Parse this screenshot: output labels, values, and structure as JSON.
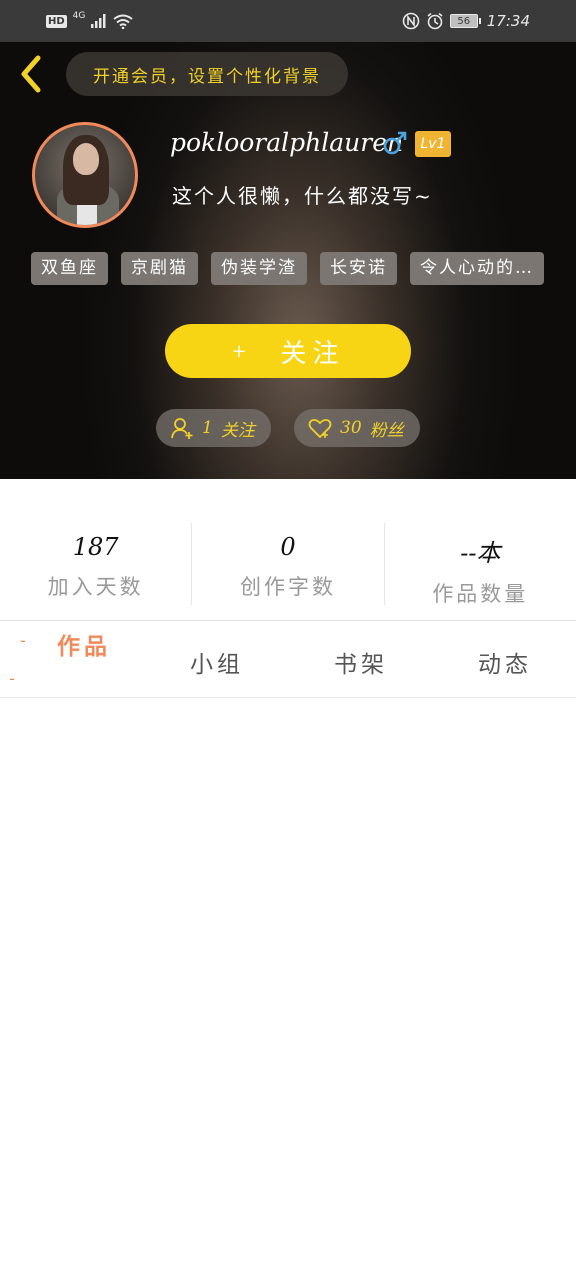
{
  "status_bar": {
    "hd": "HD",
    "network": "4G",
    "battery": "56",
    "time": "17:34",
    "icons": [
      "signal-icon",
      "wifi-icon",
      "nfc-icon",
      "alarm-icon",
      "battery-icon"
    ]
  },
  "header": {
    "member_banner": "开通会员，设置个性化背景",
    "username": "poklooralphlauren",
    "gender": "male",
    "level": "Lv1",
    "bio": "这个人很懒，什么都没写~",
    "tags": [
      "双鱼座",
      "京剧猫",
      "伪装学渣",
      "长安诺",
      "令人心动的…"
    ],
    "follow_plus": "+",
    "follow_label": "关注",
    "following_count": "1",
    "following_label": "关注",
    "fans_count": "30",
    "fans_label": "粉丝",
    "colors": {
      "accent": "#f7d514",
      "badge": "#f0b432",
      "avatar_ring": "#f08a5a"
    }
  },
  "stats": [
    {
      "value": "187",
      "label": "加入天数"
    },
    {
      "value": "0",
      "label": "创作字数"
    },
    {
      "value": "--本",
      "label": "作品数量"
    }
  ],
  "tabs": [
    {
      "label": "作品",
      "active": true
    },
    {
      "label": "小组",
      "active": false
    },
    {
      "label": "书架",
      "active": false
    },
    {
      "label": "动态",
      "active": false
    }
  ],
  "tab_marks": [
    "-",
    "-"
  ]
}
